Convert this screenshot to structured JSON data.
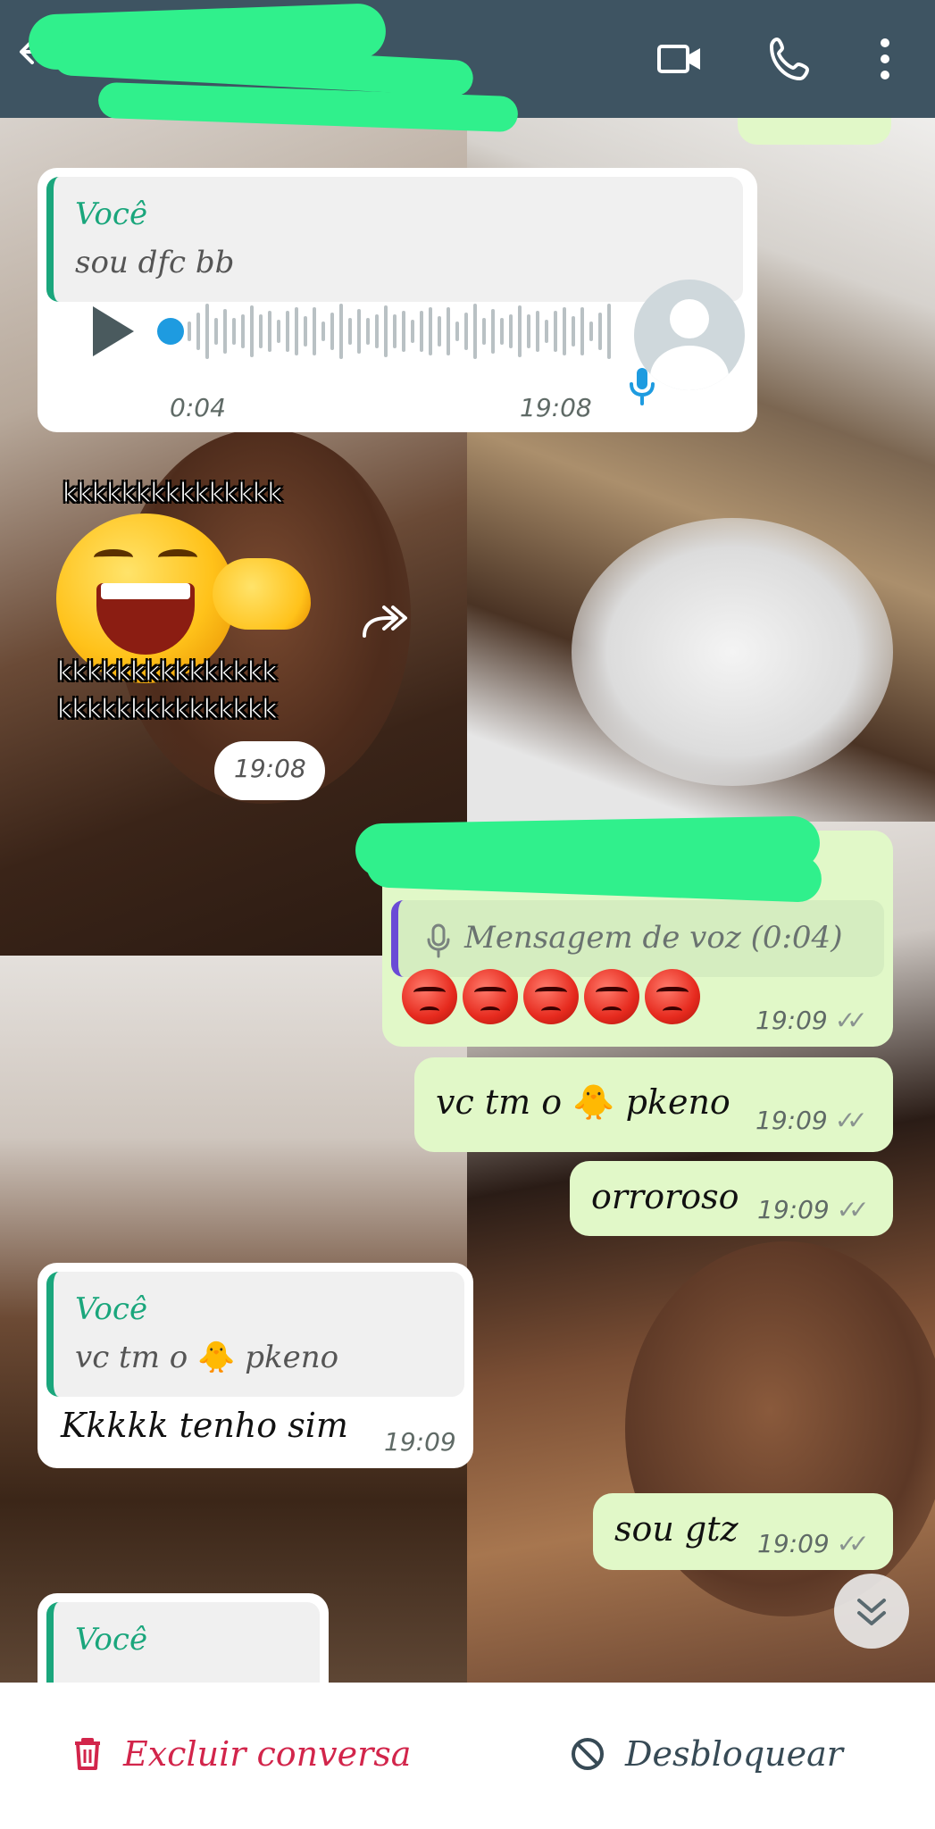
{
  "header": {
    "contact_name": "",
    "icons": [
      "back-arrow-icon",
      "video-call-icon",
      "phone-call-icon",
      "more-options-icon"
    ]
  },
  "messages": [
    {
      "type": "incoming-voice-reply",
      "quote_author": "Você",
      "quote_text": "sou dfc bb",
      "voice_duration": "0:04",
      "time": "19:08"
    },
    {
      "type": "incoming-sticker",
      "sticker_lines": [
        "kkkkkkkkkkkkkkk",
        "kkkkkkkkkkkkkkk",
        "kkkkkkkkkkkkkkk"
      ],
      "time": "19:08"
    },
    {
      "type": "outgoing-reply",
      "quote_text": "Mensagem de voz (0:04)",
      "body": "😡😡😡😡😡",
      "time": "19:09"
    },
    {
      "type": "outgoing",
      "body_before": "vc tm o",
      "emoji": "🐥",
      "body_after": "pkeno",
      "time": "19:09"
    },
    {
      "type": "outgoing",
      "body": "orroroso",
      "time": "19:09"
    },
    {
      "type": "incoming-reply",
      "quote_author": "Você",
      "quote_before": "vc tm o",
      "quote_emoji": "🐥",
      "quote_after": "pkeno",
      "body": "Kkkkk tenho sim",
      "time": "19:09"
    },
    {
      "type": "outgoing",
      "body": "sou gtz",
      "time": "19:09"
    },
    {
      "type": "incoming-reply-partial",
      "quote_author": "Você"
    }
  ],
  "colors": {
    "header_bg": "#3e5462",
    "incoming_bg": "#ffffff",
    "outgoing_bg": "#e1f8c8",
    "quote_accent": "#1aa67c",
    "voice_accent": "#1e9be0",
    "delete_color": "#d2254b",
    "unblock_color": "#374a55"
  },
  "bottom_bar": {
    "delete_label": "Excluir conversa",
    "unblock_label": "Desbloquear",
    "icons": [
      "trash-icon",
      "block-icon"
    ]
  }
}
